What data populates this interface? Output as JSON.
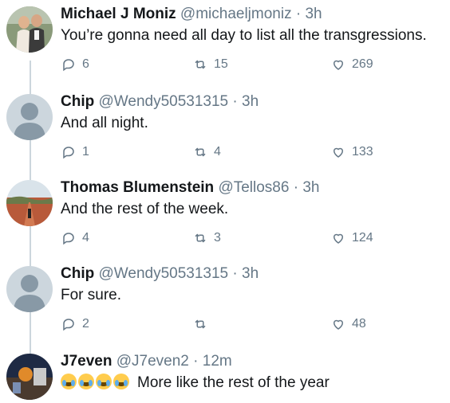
{
  "tweets": [
    {
      "name": "Michael J Moniz",
      "handle": "@michaeljmoniz",
      "time": "3h",
      "text": "You’re gonna need all day to list all the transgressions.",
      "replies": "6",
      "retweets": "15",
      "likes": "269"
    },
    {
      "name": "Chip",
      "handle": "@Wendy50531315",
      "time": "3h",
      "text": "And all night.",
      "replies": "1",
      "retweets": "4",
      "likes": "133"
    },
    {
      "name": "Thomas Blumenstein",
      "handle": "@Tellos86",
      "time": "3h",
      "text": "And the rest of the week.",
      "replies": "4",
      "retweets": "3",
      "likes": "124"
    },
    {
      "name": "Chip",
      "handle": "@Wendy50531315",
      "time": "3h",
      "text": "For sure.",
      "replies": "2",
      "retweets": "",
      "likes": "48"
    },
    {
      "name": "J7even",
      "handle": "@J7even2",
      "time": "12m",
      "emojis": "😂😂😂😂",
      "text": "More like the rest of the year"
    }
  ],
  "separator": "·",
  "colors": {
    "muted": "#657786",
    "thread_line": "#ccd6dd",
    "text": "#14171a"
  }
}
